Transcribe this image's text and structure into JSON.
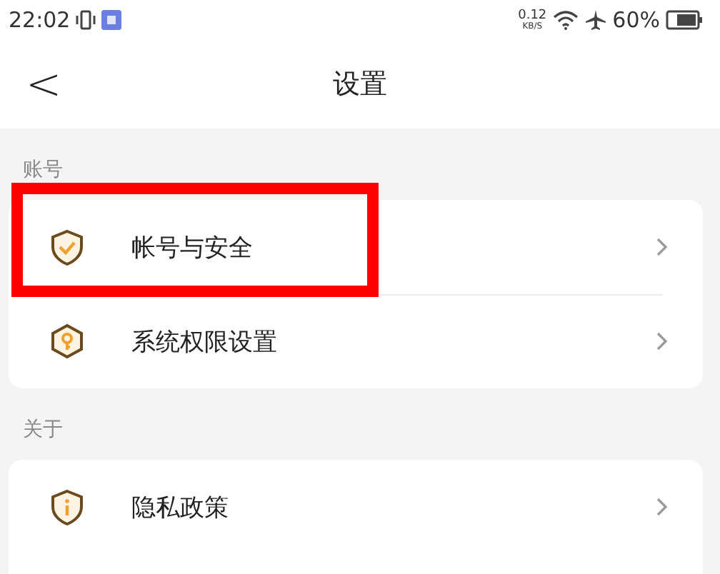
{
  "status_bar": {
    "time": "22:02",
    "net_speed": "0.12",
    "net_unit": "KB/S",
    "battery": "60%"
  },
  "header": {
    "back": "<",
    "title": "设置"
  },
  "sections": [
    {
      "label": "账号",
      "items": [
        {
          "kind": "shield-check",
          "label": "帐号与安全",
          "highlighted": true
        },
        {
          "kind": "hex-key",
          "label": "系统权限设置",
          "highlighted": false
        }
      ]
    },
    {
      "label": "关于",
      "items": [
        {
          "kind": "shield-info",
          "label": "隐私政策",
          "highlighted": false
        }
      ]
    }
  ]
}
